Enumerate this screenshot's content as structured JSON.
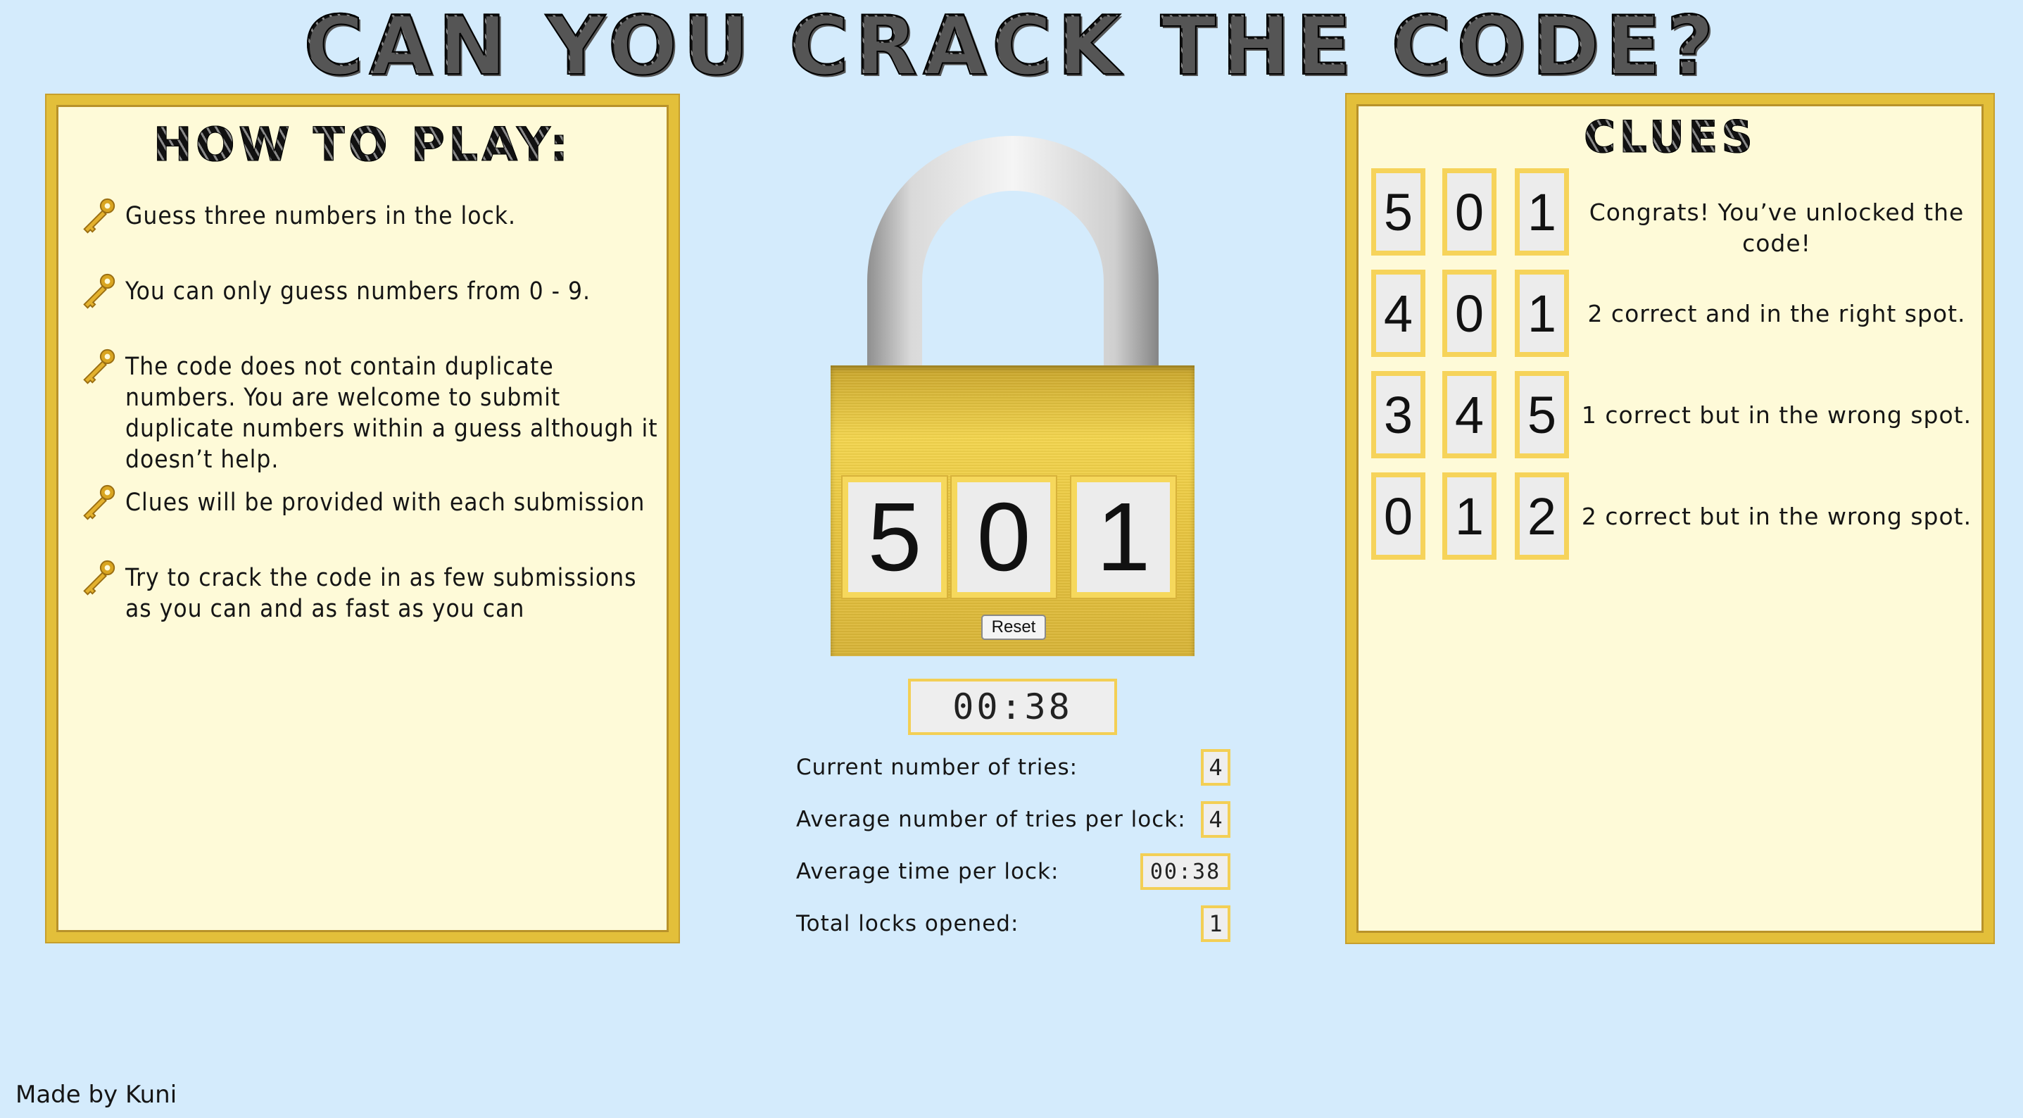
{
  "title": "CAN YOU CRACK THE CODE?",
  "how_to_play": {
    "heading": "HOW TO PLAY:",
    "icon": "key-icon",
    "rules": [
      "Guess three numbers in the lock.",
      "You can only guess numbers from 0 - 9.",
      "The code does not contain duplicate numbers. You are welcome to submit duplicate numbers within a guess although it doesn’t help.",
      "Clues will be provided with each submission",
      "Try to crack the code in as few submissions as you can and as fast as you can"
    ]
  },
  "lock": {
    "digits": [
      "5",
      "0",
      "1"
    ],
    "reset_label": "Reset",
    "colors": {
      "body": "#e9c640",
      "shackle": "#b9b9b9",
      "dial_border": "#f6d85c"
    }
  },
  "timer": "00:38",
  "stats": {
    "current_tries_label": "Current number of tries:",
    "current_tries": "4",
    "avg_tries_label": "Average number of tries per lock:",
    "avg_tries": "4",
    "avg_time_label": "Average time per lock:",
    "avg_time": "00:38",
    "total_locks_label": "Total locks opened:",
    "total_locks": "1"
  },
  "clues": {
    "heading": "CLUES",
    "rows": [
      {
        "digits": [
          "5",
          "0",
          "1"
        ],
        "text": "Congrats! You’ve unlocked the code!"
      },
      {
        "digits": [
          "4",
          "0",
          "1"
        ],
        "text": "2 correct and in the right spot."
      },
      {
        "digits": [
          "3",
          "4",
          "5"
        ],
        "text": "1 correct but in the wrong spot."
      },
      {
        "digits": [
          "0",
          "1",
          "2"
        ],
        "text": "2 correct but in the wrong spot."
      }
    ]
  },
  "credit": "Made by Kuni",
  "colors": {
    "background": "#d4ebfc",
    "panel": "#fefad8",
    "panel_border": "#e3bf3a"
  }
}
